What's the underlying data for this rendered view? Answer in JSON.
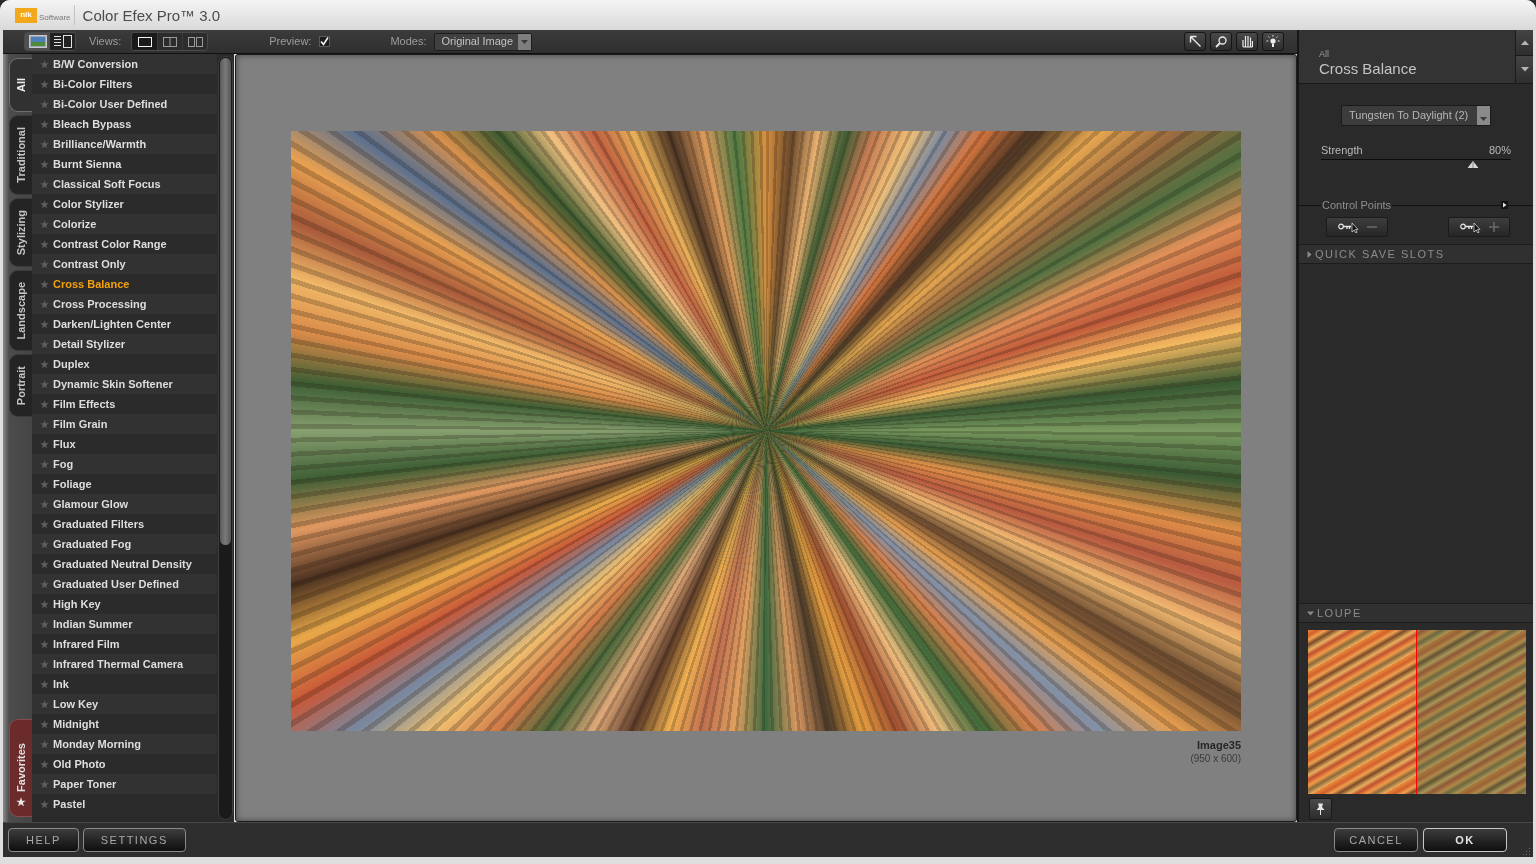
{
  "window": {
    "title": "Color Efex Pro™ 3.0",
    "logo": {
      "brand": "nik",
      "subtitle": "Software"
    }
  },
  "toolbar": {
    "browser_modes": [
      {
        "kind": "thumbnails",
        "selected": true
      },
      {
        "kind": "list",
        "selected": false
      }
    ],
    "views_label": "Views:",
    "views": [
      {
        "kind": "single",
        "selected": true
      },
      {
        "kind": "split",
        "selected": false
      },
      {
        "kind": "side_by_side",
        "selected": false
      }
    ],
    "preview": {
      "label": "Preview:",
      "checked": true
    },
    "modes": {
      "label": "Modes:",
      "value": "Original Image"
    },
    "tools": [
      {
        "kind": "pointer"
      },
      {
        "kind": "zoom"
      },
      {
        "kind": "hand"
      },
      {
        "kind": "light"
      }
    ]
  },
  "category_tabs": [
    {
      "label": "All",
      "selected": true
    },
    {
      "label": "Traditional",
      "selected": false
    },
    {
      "label": "Stylizing",
      "selected": false
    },
    {
      "label": "Landscape",
      "selected": false
    },
    {
      "label": "Portrait",
      "selected": false
    }
  ],
  "favorites_tab": {
    "label": "Favorites"
  },
  "filters": [
    {
      "label": "B/W Conversion",
      "selected": false
    },
    {
      "label": "Bi-Color Filters",
      "selected": false
    },
    {
      "label": "Bi-Color User Defined",
      "selected": false
    },
    {
      "label": "Bleach Bypass",
      "selected": false
    },
    {
      "label": "Brilliance/Warmth",
      "selected": false
    },
    {
      "label": "Burnt Sienna",
      "selected": false
    },
    {
      "label": "Classical Soft Focus",
      "selected": false
    },
    {
      "label": "Color Stylizer",
      "selected": false
    },
    {
      "label": "Colorize",
      "selected": false
    },
    {
      "label": "Contrast Color Range",
      "selected": false
    },
    {
      "label": "Contrast Only",
      "selected": false
    },
    {
      "label": "Cross Balance",
      "selected": true
    },
    {
      "label": "Cross Processing",
      "selected": false
    },
    {
      "label": "Darken/Lighten Center",
      "selected": false
    },
    {
      "label": "Detail Stylizer",
      "selected": false
    },
    {
      "label": "Duplex",
      "selected": false
    },
    {
      "label": "Dynamic Skin Softener",
      "selected": false
    },
    {
      "label": "Film Effects",
      "selected": false
    },
    {
      "label": "Film Grain",
      "selected": false
    },
    {
      "label": "Flux",
      "selected": false
    },
    {
      "label": "Fog",
      "selected": false
    },
    {
      "label": "Foliage",
      "selected": false
    },
    {
      "label": "Glamour Glow",
      "selected": false
    },
    {
      "label": "Graduated Filters",
      "selected": false
    },
    {
      "label": "Graduated Fog",
      "selected": false
    },
    {
      "label": "Graduated Neutral Density",
      "selected": false
    },
    {
      "label": "Graduated User Defined",
      "selected": false
    },
    {
      "label": "High Key",
      "selected": false
    },
    {
      "label": "Indian Summer",
      "selected": false
    },
    {
      "label": "Infrared Film",
      "selected": false
    },
    {
      "label": "Infrared Thermal Camera",
      "selected": false
    },
    {
      "label": "Ink",
      "selected": false
    },
    {
      "label": "Low Key",
      "selected": false
    },
    {
      "label": "Midnight",
      "selected": false
    },
    {
      "label": "Monday Morning",
      "selected": false
    },
    {
      "label": "Old Photo",
      "selected": false
    },
    {
      "label": "Paper Toner",
      "selected": false
    },
    {
      "label": "Pastel",
      "selected": false
    }
  ],
  "preview_image": {
    "name": "Image35",
    "dimensions": "(950 x 600)"
  },
  "filter_panel": {
    "category": "All",
    "title": "Cross Balance",
    "preset": "Tungsten To Daylight (2)",
    "sliders": [
      {
        "label": "Strength",
        "reading": "80%",
        "level": 0.8
      }
    ],
    "control_points": {
      "label": "Control Points",
      "buttons": [
        {
          "kind": "remove"
        },
        {
          "kind": "add"
        }
      ]
    }
  },
  "sections": [
    {
      "kind": "quick_save",
      "label": "QUICK SAVE SLOTS",
      "expanded": false
    },
    {
      "kind": "loupe",
      "label": "LOUPE",
      "expanded": true
    }
  ],
  "footer": {
    "left_buttons": [
      {
        "label": "HELP"
      },
      {
        "label": "SETTINGS"
      }
    ],
    "right_buttons": [
      {
        "label": "CANCEL",
        "default": false
      },
      {
        "label": "OK",
        "default": true
      }
    ]
  }
}
